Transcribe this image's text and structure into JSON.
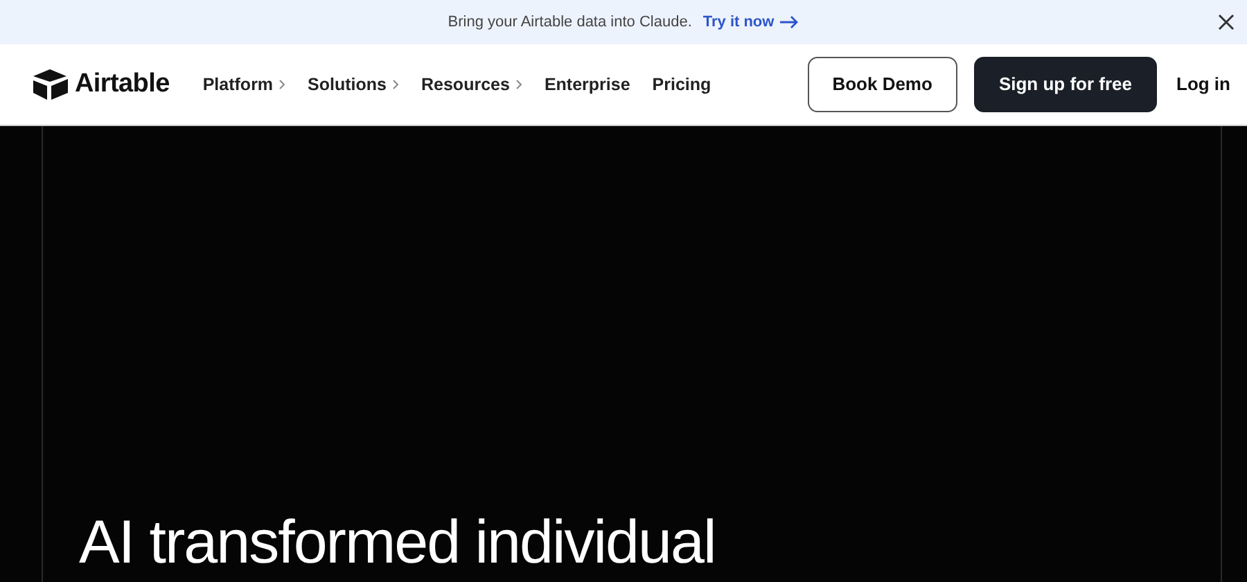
{
  "banner": {
    "message": "Bring your Airtable data into Claude.",
    "link": "Try it now"
  },
  "header": {
    "logo": "Airtable",
    "nav": [
      {
        "label": "Platform",
        "kind": "menu"
      },
      {
        "label": "Solutions",
        "kind": "menu"
      },
      {
        "label": "Resources",
        "kind": "menu"
      },
      {
        "label": "Enterprise",
        "kind": "link"
      },
      {
        "label": "Pricing",
        "kind": "link"
      }
    ],
    "buttons": [
      {
        "label": "Book Demo",
        "kind": "outline"
      },
      {
        "label": "Sign up for free",
        "kind": "solid"
      },
      {
        "label": "Log in",
        "kind": "plain"
      }
    ]
  },
  "hero": {
    "heading": "AI transformed individual"
  }
}
